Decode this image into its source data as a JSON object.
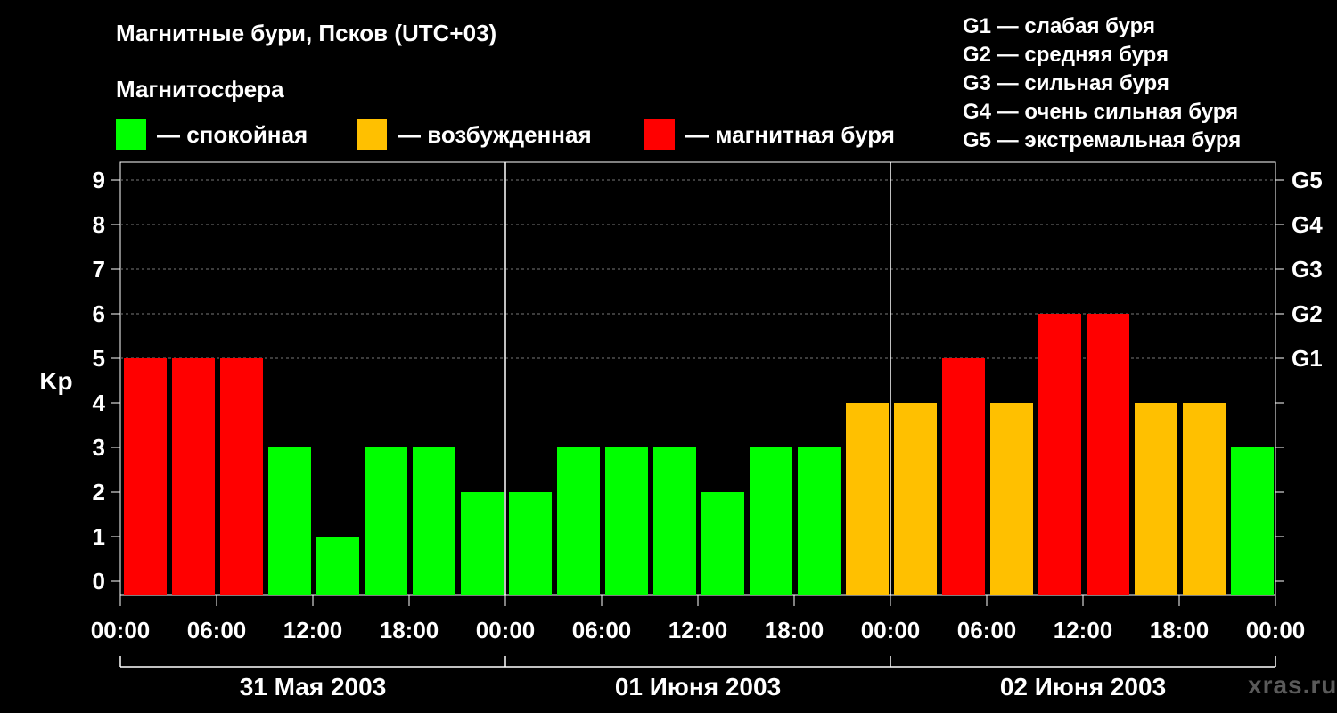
{
  "header": {
    "title": "Магнитные бури, Псков (UTC+03)",
    "magnetosphere_label": "Магнитосфера"
  },
  "legend": [
    {
      "label": "— спокойная",
      "color": "#00ff00"
    },
    {
      "label": "— возбужденная",
      "color": "#ffc000"
    },
    {
      "label": "— магнитная буря",
      "color": "#ff0000"
    }
  ],
  "g_scale": [
    "G1 — слабая буря",
    "G2 — средняя буря",
    "G3 — сильная буря",
    "G4 — очень сильная буря",
    "G5 — экстремальная буря"
  ],
  "watermark": "xras.ru",
  "chart_data": {
    "type": "bar",
    "ylabel": "Kp",
    "ylim": [
      0,
      9
    ],
    "y_ticks": [
      0,
      1,
      2,
      3,
      4,
      5,
      6,
      7,
      8,
      9
    ],
    "right_ticks": [
      {
        "value": 5,
        "label": "G1"
      },
      {
        "value": 6,
        "label": "G2"
      },
      {
        "value": 7,
        "label": "G3"
      },
      {
        "value": 8,
        "label": "G4"
      },
      {
        "value": 9,
        "label": "G5"
      }
    ],
    "grid": "dashed horizontal at 5-9",
    "x_tick_labels": [
      "00:00",
      "06:00",
      "12:00",
      "18:00",
      "00:00",
      "06:00",
      "12:00",
      "18:00",
      "00:00",
      "06:00",
      "12:00",
      "18:00",
      "00:00"
    ],
    "days": [
      "31 Мая 2003",
      "01 Июня 2003",
      "02 Июня 2003"
    ],
    "values": [
      5,
      5,
      5,
      3,
      1,
      3,
      3,
      2,
      2,
      3,
      3,
      3,
      2,
      3,
      3,
      4,
      4,
      5,
      4,
      6,
      6,
      4,
      4,
      3
    ],
    "status": [
      "storm",
      "storm",
      "storm",
      "quiet",
      "quiet",
      "quiet",
      "quiet",
      "quiet",
      "quiet",
      "quiet",
      "quiet",
      "quiet",
      "quiet",
      "quiet",
      "quiet",
      "active",
      "active",
      "storm",
      "active",
      "storm",
      "storm",
      "active",
      "active",
      "quiet"
    ],
    "colors": {
      "quiet": "#00ff00",
      "active": "#ffc000",
      "storm": "#ff0000"
    }
  }
}
